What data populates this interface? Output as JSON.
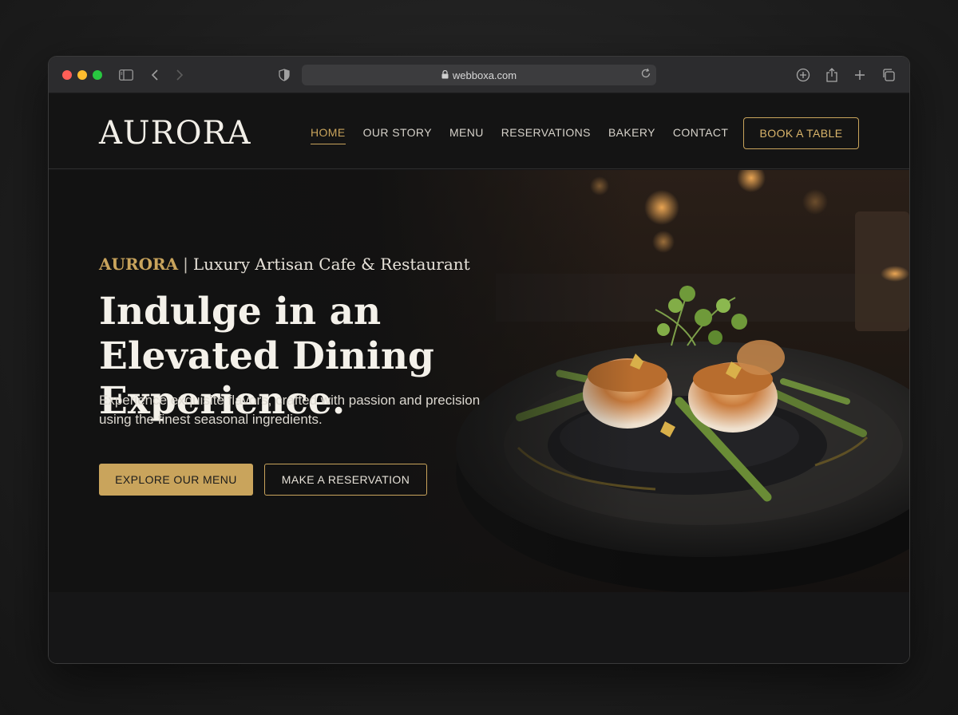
{
  "browser": {
    "url": "webboxa.com"
  },
  "nav": {
    "logo": "AURORA",
    "items": [
      {
        "label": "HOME",
        "active": true
      },
      {
        "label": "OUR STORY",
        "active": false
      },
      {
        "label": "MENU",
        "active": false
      },
      {
        "label": "RESERVATIONS",
        "active": false
      },
      {
        "label": "BAKERY",
        "active": false
      },
      {
        "label": "CONTACT",
        "active": false
      }
    ],
    "cta": "BOOK A TABLE"
  },
  "hero": {
    "brand": "AURORA",
    "separator": "|",
    "tagline": "Luxury Artisan Cafe & Restaurant",
    "headline": "Indulge in an Elevated Dining Experience.",
    "subtext": "Experience exquisite flavors, crafted with passion and precision using the finest seasonal ingredients.",
    "primary_button": "EXPLORE OUR MENU",
    "secondary_button": "MAKE A RESERVATION"
  },
  "colors": {
    "accent_gold": "#c9a45c",
    "background": "#161617"
  }
}
